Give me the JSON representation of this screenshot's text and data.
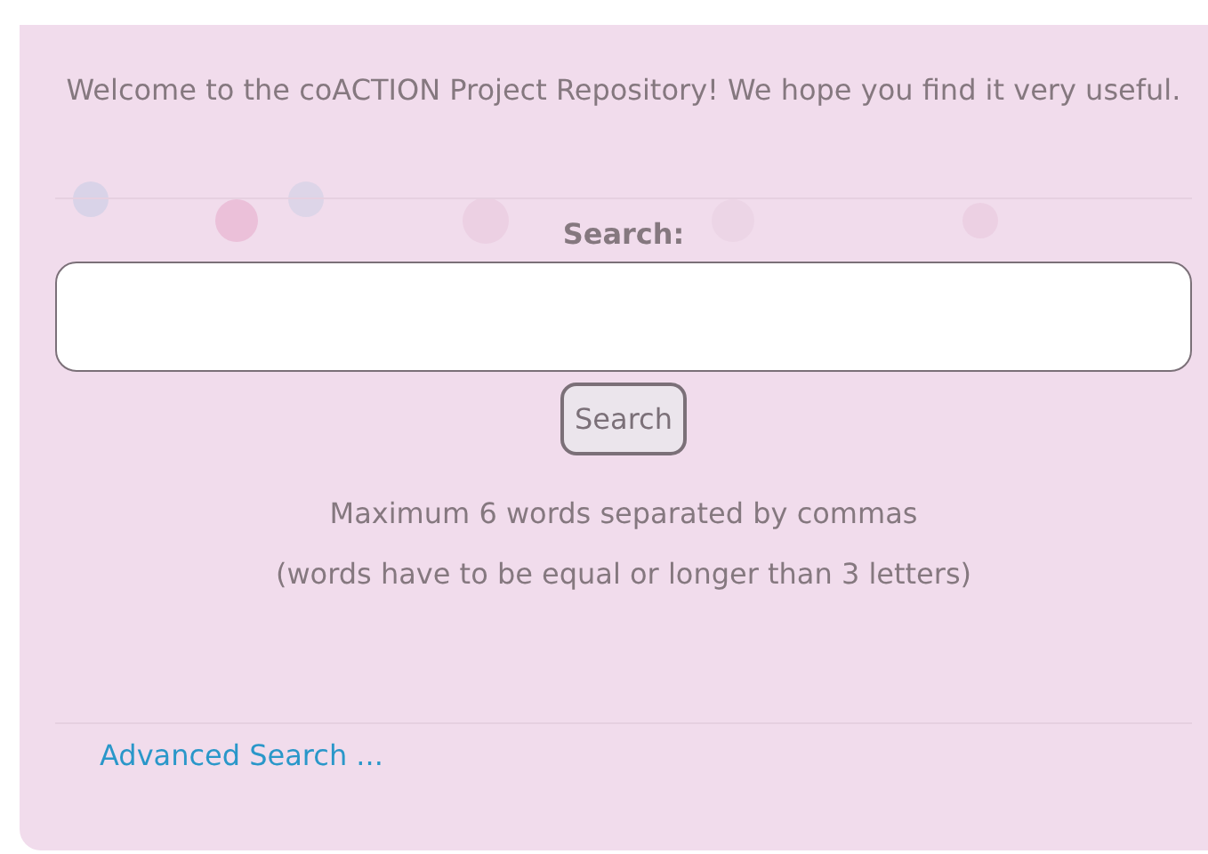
{
  "welcome": "Welcome to the coACTION Project Repository! We hope you find it very useful.",
  "search": {
    "label": "Search:",
    "button": "Search"
  },
  "hints": [
    "Maximum 6 words separated by commas",
    "(words have to be equal or longer than 3 letters)"
  ],
  "advanced_link": "Advanced Search ..."
}
